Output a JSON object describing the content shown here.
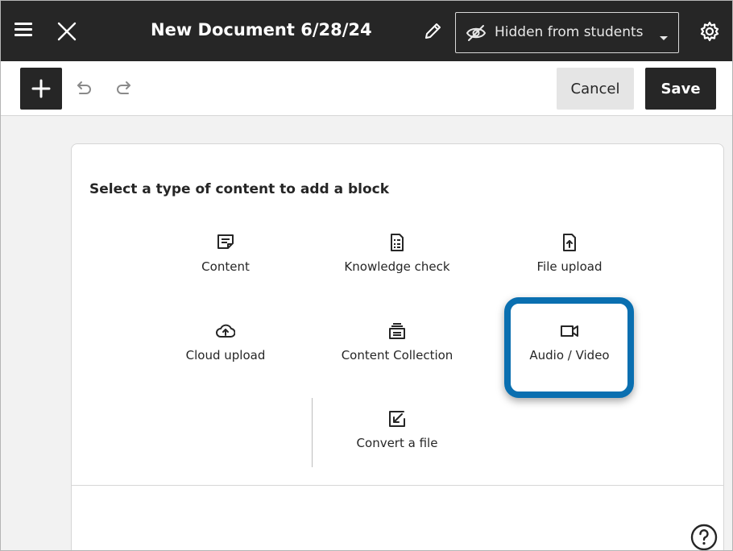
{
  "header": {
    "title": "New Document 6/28/24",
    "visibility_label": "Hidden from students"
  },
  "toolbar": {
    "cancel_label": "Cancel",
    "save_label": "Save"
  },
  "panel": {
    "heading": "Select a type of content to add a block",
    "options": [
      {
        "label": "Content",
        "icon": "content-icon"
      },
      {
        "label": "Knowledge check",
        "icon": "knowledge-check-icon"
      },
      {
        "label": "File upload",
        "icon": "file-upload-icon"
      },
      {
        "label": "Cloud upload",
        "icon": "cloud-upload-icon"
      },
      {
        "label": "Content Collection",
        "icon": "content-collection-icon"
      },
      {
        "label": "Audio / Video",
        "icon": "video-camera-icon",
        "highlighted": true
      },
      {
        "label": "Convert a file",
        "icon": "convert-file-icon"
      }
    ]
  },
  "colors": {
    "header_bg": "#262626",
    "highlight": "#0a6fb0",
    "button_dark": "#262626",
    "button_light": "#e5e5e5"
  }
}
